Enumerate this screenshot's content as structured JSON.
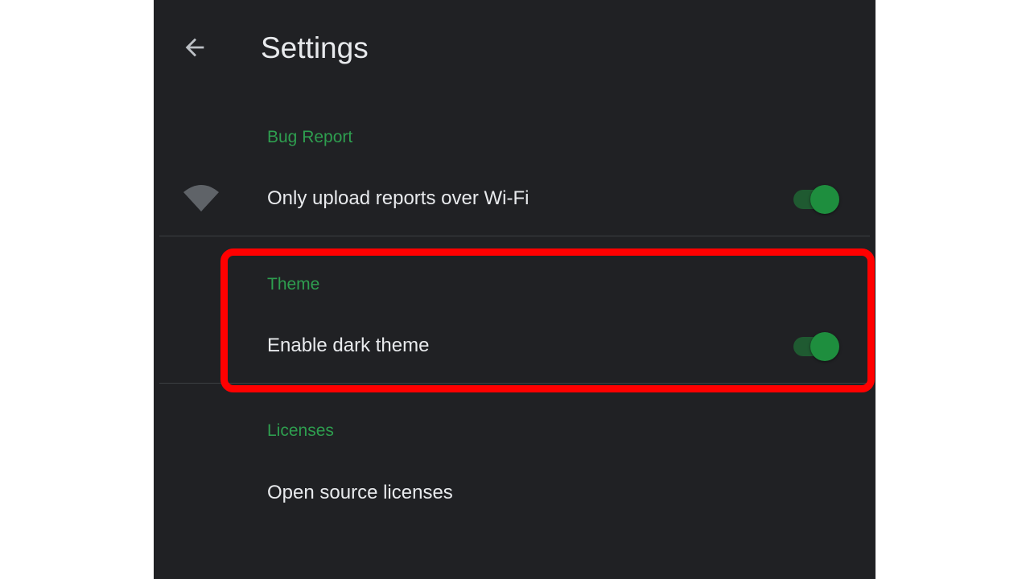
{
  "header": {
    "title": "Settings",
    "back_icon": "arrow-back-icon"
  },
  "colors": {
    "background": "#202124",
    "accent": "#1e8e3e",
    "section_title": "#2e9e4f",
    "text": "#e8eaed",
    "highlight": "#ff0000"
  },
  "sections": {
    "bug_report": {
      "title": "Bug Report",
      "wifi_pref": {
        "label": "Only upload reports over Wi-Fi",
        "icon": "wifi-icon",
        "enabled": true
      }
    },
    "theme": {
      "title": "Theme",
      "dark_pref": {
        "label": "Enable dark theme",
        "enabled": true
      }
    },
    "licenses": {
      "title": "Licenses",
      "open_source": {
        "label": "Open source licenses"
      }
    }
  }
}
